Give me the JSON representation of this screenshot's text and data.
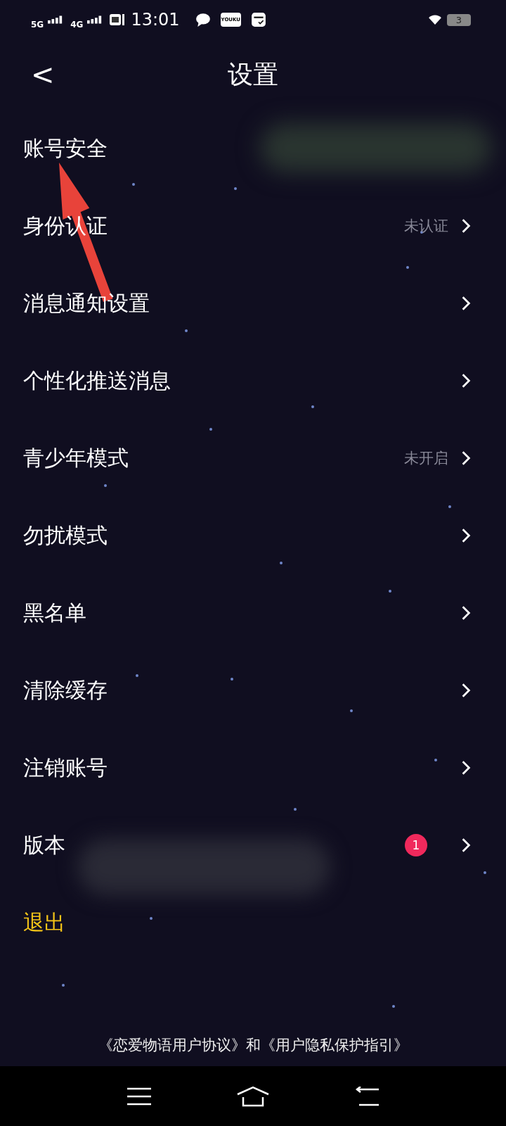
{
  "status_bar": {
    "network_1": "5G",
    "network_2": "4G",
    "time": "13:01",
    "app_badge": "YOUKU",
    "battery": "3"
  },
  "header": {
    "title": "设置",
    "back": "<"
  },
  "rows": [
    {
      "kind": "link",
      "label": "账号安全",
      "chevron": false
    },
    {
      "kind": "link",
      "label": "身份认证",
      "value": "未认证"
    },
    {
      "kind": "link",
      "label": "消息通知设置"
    },
    {
      "kind": "link",
      "label": "个性化推送消息"
    },
    {
      "kind": "link",
      "label": "青少年模式",
      "value": "未开启"
    },
    {
      "kind": "link",
      "label": "勿扰模式"
    },
    {
      "kind": "link",
      "label": "黑名单"
    },
    {
      "kind": "link",
      "label": "清除缓存"
    },
    {
      "kind": "link",
      "label": "注销账号"
    },
    {
      "kind": "link",
      "label": "版本",
      "badge": "1"
    },
    {
      "kind": "action",
      "label": "退出"
    }
  ],
  "footer": {
    "links": [
      "《恋爱物语用户协议》",
      "《用户隐私保护指引》"
    ],
    "joiner": "和"
  }
}
